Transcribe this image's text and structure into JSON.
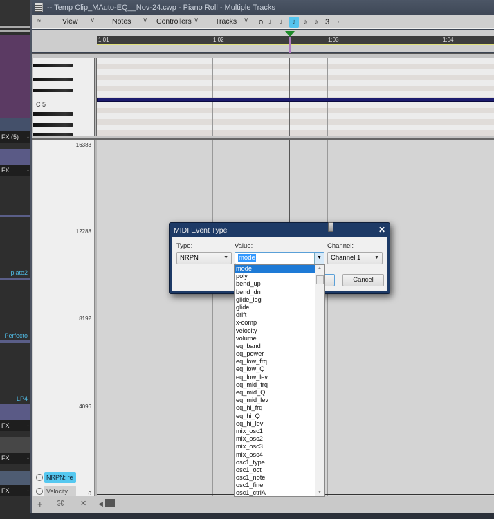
{
  "window": {
    "title": "-- Temp Clip_MAuto-EQ__Nov-24.cwp - Piano Roll - Multiple Tracks"
  },
  "menubar": {
    "items": [
      {
        "label": "View"
      },
      {
        "label": "Notes"
      },
      {
        "label": "Controllers"
      },
      {
        "label": "Tracks"
      }
    ],
    "durations": [
      {
        "name": "whole-note",
        "glyph": "ο",
        "selected": false
      },
      {
        "name": "half-note",
        "glyph": "♩",
        "selected": false
      },
      {
        "name": "quarter-note",
        "glyph": "♩",
        "selected": false
      },
      {
        "name": "eighth-note",
        "glyph": "♪",
        "selected": true
      },
      {
        "name": "sixteenth-note",
        "glyph": "♪",
        "selected": false
      },
      {
        "name": "thirtysecond-note",
        "glyph": "♪",
        "selected": false
      },
      {
        "name": "triplet",
        "glyph": "3",
        "selected": false
      },
      {
        "name": "dotted",
        "glyph": "·",
        "selected": false
      }
    ]
  },
  "ruler": {
    "ticks": [
      "1:01",
      "1:02",
      "1:03",
      "1:04"
    ]
  },
  "piano": {
    "key_label": "C 5"
  },
  "tracks": [
    {
      "label": "FX (5)"
    },
    {
      "label": "FX"
    },
    {
      "label": "plate2"
    },
    {
      "label": "Perfecto"
    },
    {
      "label": "LP4"
    },
    {
      "label": "FX"
    },
    {
      "label": "FX"
    },
    {
      "label": "FX"
    }
  ],
  "controller": {
    "y_values": [
      "16383",
      "12288",
      "8192",
      "4096",
      "0"
    ],
    "lanes": [
      {
        "label": "NRPN: re",
        "active": true
      },
      {
        "label": "Velocity",
        "active": false
      }
    ]
  },
  "bottombar": {
    "add": "+",
    "fit": "⌘",
    "close": "✕"
  },
  "dialog": {
    "title": "MIDI Event Type",
    "type_label": "Type:",
    "type_value": "NRPN",
    "value_label": "Value:",
    "value_value": "mode",
    "channel_label": "Channel:",
    "channel_value": "Channel 1",
    "cancel": "Cancel",
    "options": [
      "mode",
      "poly",
      "bend_up",
      "bend_dn",
      "glide_log",
      "glide",
      "drift",
      "x-comp",
      "velocity",
      "volume",
      "eq_band",
      "eq_power",
      "eq_low_frq",
      "eq_low_Q",
      "eq_low_lev",
      "eq_mid_frq",
      "eq_mid_Q",
      "eq_mid_lev",
      "eq_hi_frq",
      "eq_hi_Q",
      "eq_hi_lev",
      "mix_osc1",
      "mix_osc2",
      "mix_osc3",
      "mix_osc4",
      "osc1_type",
      "osc1_oct",
      "osc1_note",
      "osc1_fine",
      "osc1_ctrlA"
    ],
    "selected_option": "mode"
  }
}
